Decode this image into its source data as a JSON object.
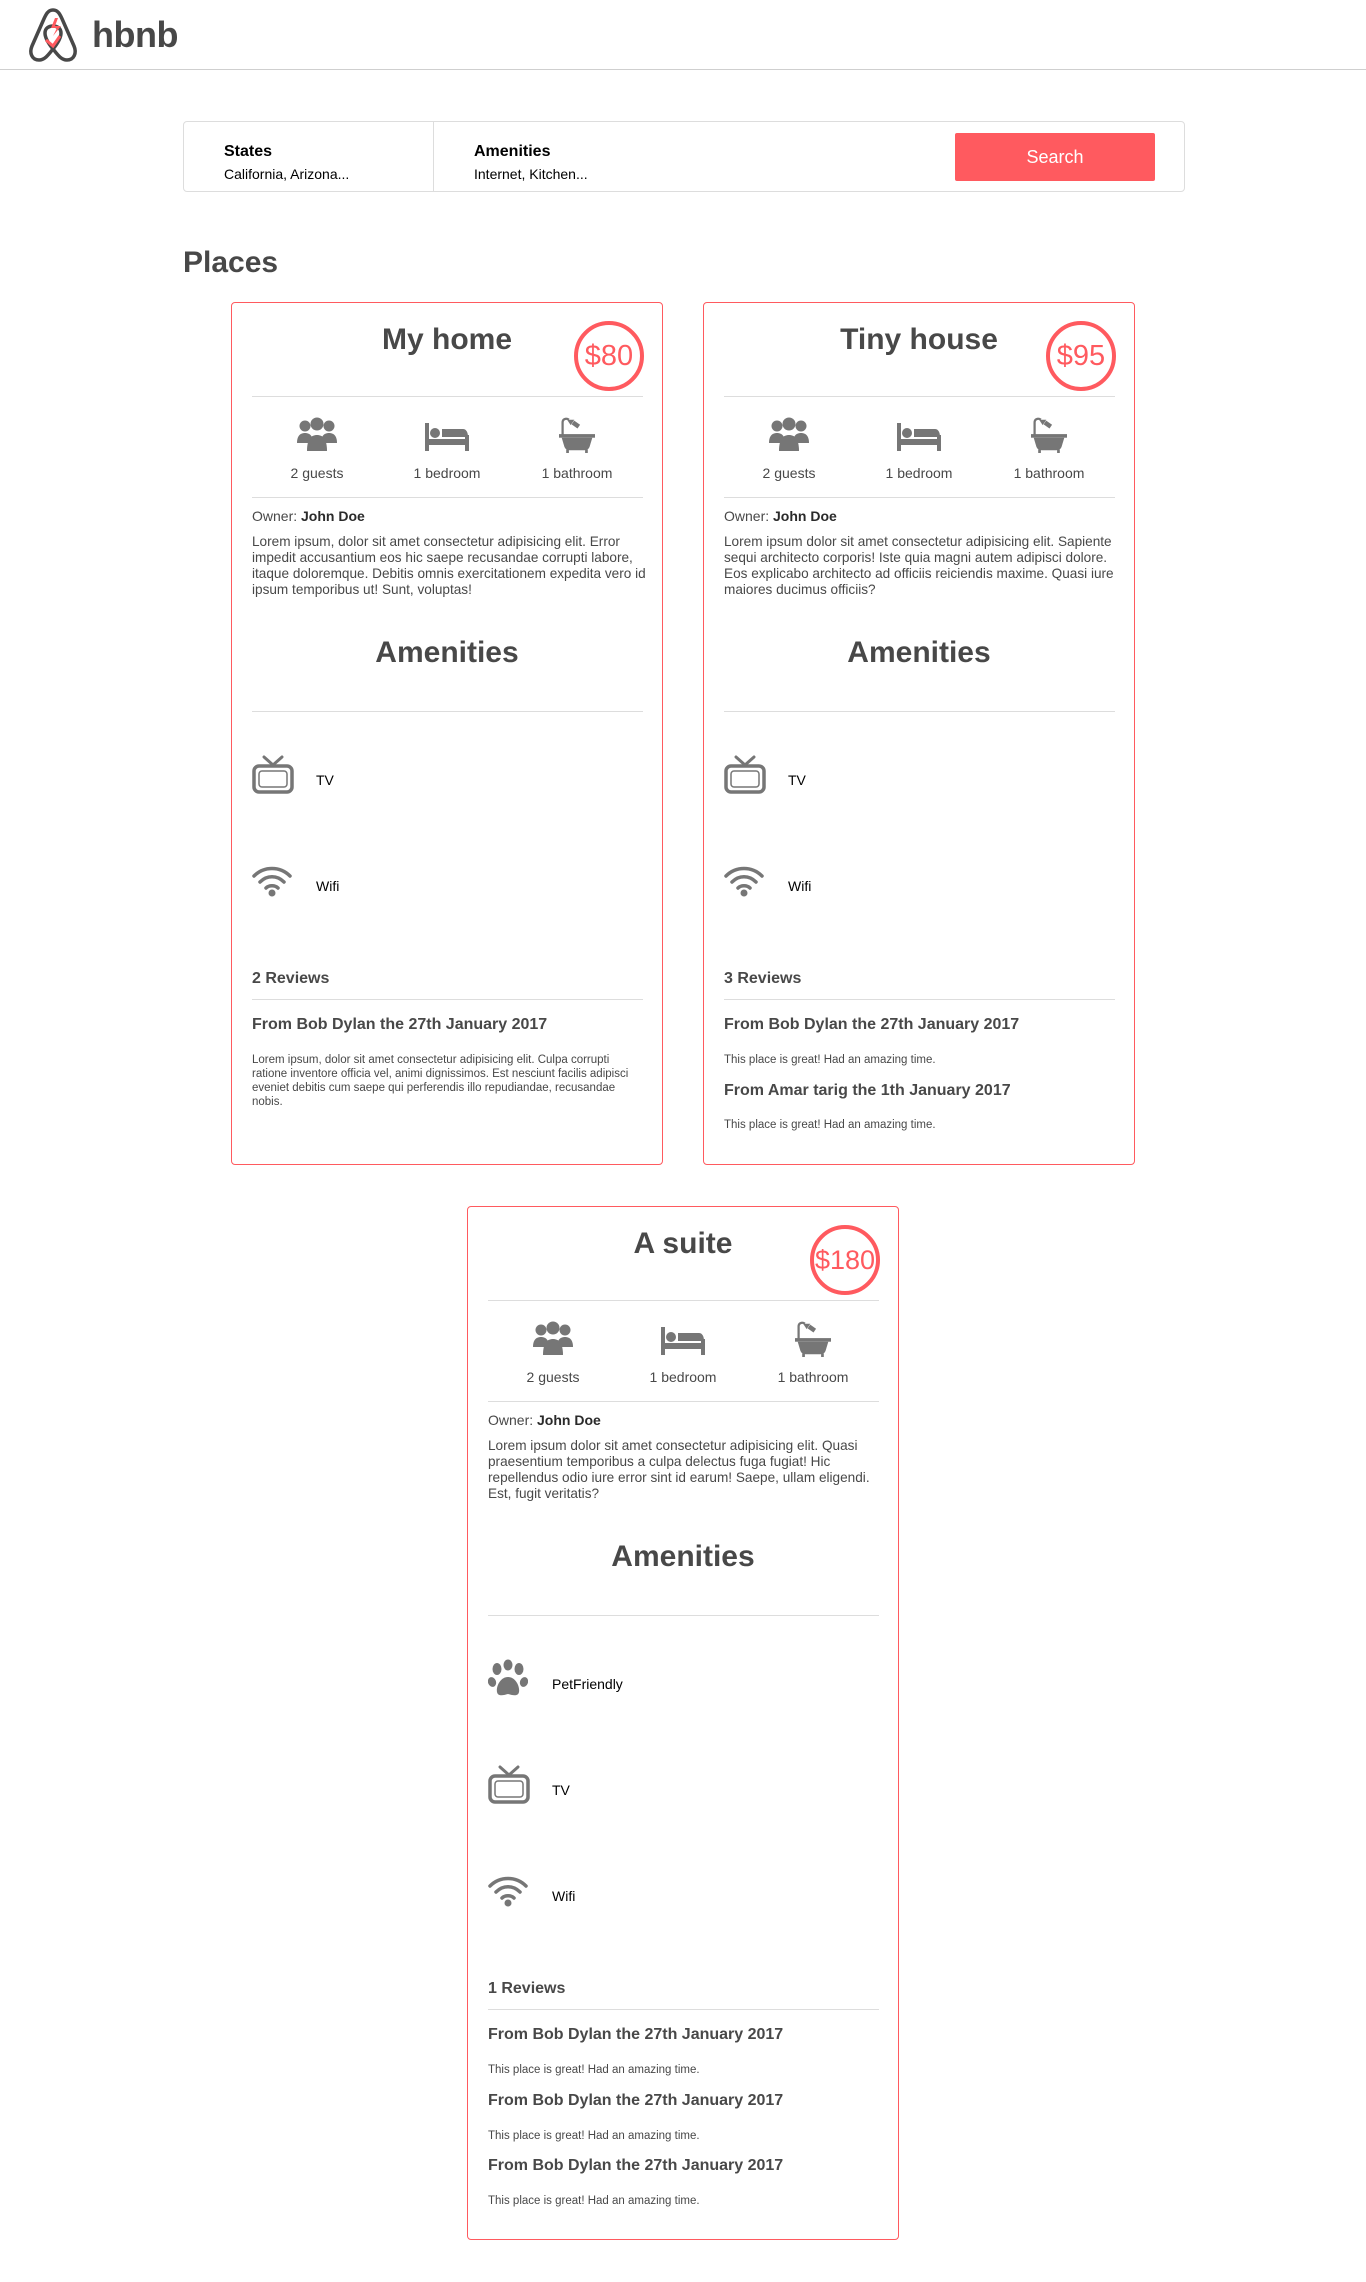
{
  "header": {
    "logo_text": "hbnb"
  },
  "filters": {
    "states": {
      "title": "States",
      "value": "California, Arizona..."
    },
    "amenities": {
      "title": "Amenities",
      "value": "Internet, Kitchen..."
    },
    "search_label": "Search"
  },
  "places_title": "Places",
  "colors": {
    "accent": "#ff5a5f",
    "text": "#484848",
    "icon": "#767676",
    "divider": "#dddddd"
  },
  "places": [
    {
      "name": "My home",
      "price": "$80",
      "guests": "2 guests",
      "bedrooms": "1 bedroom",
      "bathrooms": "1 bathroom",
      "owner_label": "Owner:",
      "owner": "John Doe",
      "description": "Lorem ipsum, dolor sit amet consectetur adipisicing elit. Error impedit accusantium eos hic saepe recusandae corrupti labore, itaque doloremque. Debitis omnis exercitationem expedita vero id ipsum temporibus ut! Sunt, voluptas!",
      "amenities_title": "Amenities",
      "amenities": [
        {
          "icon": "tv-icon",
          "label": "TV"
        },
        {
          "icon": "wifi-icon",
          "label": "Wifi"
        }
      ],
      "reviews_title": "2 Reviews",
      "reviews": [
        {
          "head": "From Bob Dylan the 27th January 2017",
          "text": "Lorem ipsum, dolor sit amet consectetur adipisicing elit. Culpa corrupti ratione inventore officia vel, animi dignissimos. Est nesciunt facilis adipisci eveniet debitis cum saepe qui perferendis illo repudiandae, recusandae nobis."
        }
      ]
    },
    {
      "name": "Tiny house",
      "price": "$95",
      "guests": "2 guests",
      "bedrooms": "1 bedroom",
      "bathrooms": "1 bathroom",
      "owner_label": "Owner:",
      "owner": "John Doe",
      "description": "Lorem ipsum dolor sit amet consectetur adipisicing elit. Sapiente sequi architecto corporis! Iste quia magni autem adipisci dolore. Eos explicabo architecto ad officiis reiciendis maxime. Quasi iure maiores ducimus officiis?",
      "amenities_title": "Amenities",
      "amenities": [
        {
          "icon": "tv-icon",
          "label": "TV"
        },
        {
          "icon": "wifi-icon",
          "label": "Wifi"
        }
      ],
      "reviews_title": "3 Reviews",
      "reviews": [
        {
          "head": "From Bob Dylan the 27th January 2017",
          "text": "This place is great! Had an amazing time."
        },
        {
          "head": "From Amar tarig the 1th January 2017",
          "text": "This place is great! Had an amazing time."
        }
      ]
    },
    {
      "name": "A suite",
      "price": "$180",
      "guests": "2 guests",
      "bedrooms": "1 bedroom",
      "bathrooms": "1 bathroom",
      "owner_label": "Owner:",
      "owner": "John Doe",
      "description": "Lorem ipsum dolor sit amet consectetur adipisicing elit. Quasi praesentium temporibus a culpa delectus fuga fugiat! Hic repellendus odio iure error sint id earum! Saepe, ullam eligendi. Est, fugit veritatis?",
      "amenities_title": "Amenities",
      "amenities": [
        {
          "icon": "paw-icon",
          "label": "PetFriendly"
        },
        {
          "icon": "tv-icon",
          "label": "TV"
        },
        {
          "icon": "wifi-icon",
          "label": "Wifi"
        }
      ],
      "reviews_title": "1 Reviews",
      "reviews": [
        {
          "head": "From Bob Dylan the 27th January 2017",
          "text": "This place is great! Had an amazing time."
        },
        {
          "head": "From Bob Dylan the 27th January 2017",
          "text": "This place is great! Had an amazing time."
        },
        {
          "head": "From Bob Dylan the 27th January 2017",
          "text": "This place is great! Had an amazing time."
        }
      ]
    }
  ]
}
